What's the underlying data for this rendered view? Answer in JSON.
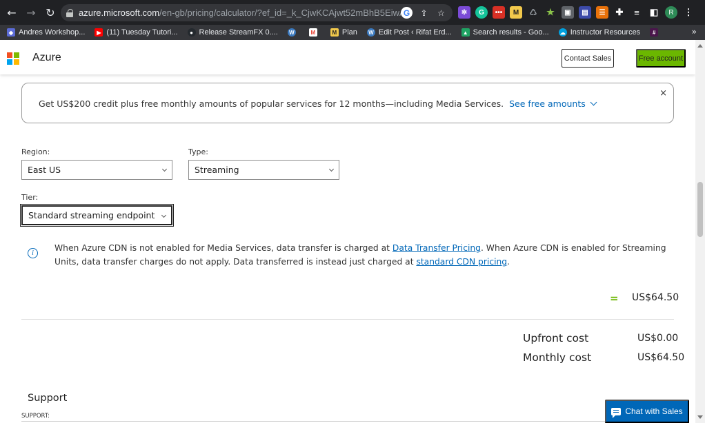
{
  "browser": {
    "url_host": "azure.microsoft.com",
    "url_rest": "/en-gb/pricing/calculator/?ef_id=_k_CjwKCAjwt52mBhB5EiwA05YKo9K-N...",
    "profile_initial": "R",
    "bookmarks": [
      {
        "label": "Andres Workshop...",
        "icon": "shield-icon",
        "color": "#5b6bd6"
      },
      {
        "label": "(11) Tuesday Tutori...",
        "icon": "youtube-icon",
        "color": "#ff0000"
      },
      {
        "label": "Release StreamFX 0....",
        "icon": "github-icon",
        "color": "#24292e"
      },
      {
        "label": "",
        "icon": "wordpress-icon",
        "color": "#3b7ac0"
      },
      {
        "label": "",
        "icon": "gmail-icon",
        "color": "#ea4335"
      },
      {
        "label": "Plan",
        "icon": "miro-icon",
        "color": "#f2c94c"
      },
      {
        "label": "Edit Post ‹ Rifat Erd...",
        "icon": "wordpress-icon",
        "color": "#3b7ac0"
      },
      {
        "label": "Search results - Goo...",
        "icon": "google-drive-icon",
        "color": "#1fa463"
      },
      {
        "label": "Instructor Resources",
        "icon": "salesforce-icon",
        "color": "#00a1e0"
      },
      {
        "label": "",
        "icon": "slack-icon",
        "color": "#e01e5a"
      }
    ]
  },
  "header": {
    "brand": "Azure",
    "contact_sales": "Contact Sales",
    "free_account": "Free account"
  },
  "banner": {
    "text": "Get US$200 credit plus free monthly amounts of popular services for 12 months—including Media Services.",
    "link": "See free amounts",
    "close": "×"
  },
  "form": {
    "region_label": "Region:",
    "region_value": "East US",
    "type_label": "Type:",
    "type_value": "Streaming",
    "tier_label": "Tier:",
    "tier_value": "Standard streaming endpoint"
  },
  "info": {
    "part1": "When Azure CDN is not enabled for Media Services, data transfer is charged at ",
    "link1": "Data Transfer Pricing",
    "part2": ". When Azure CDN is enabled for Streaming Units, data transfer charges do not apply. Data transferred is instead just charged at ",
    "link2": "standard CDN pricing",
    "part3": "."
  },
  "pricing": {
    "equals": "=",
    "line_total": "US$64.50",
    "upfront_label": "Upfront cost",
    "upfront_value": "US$0.00",
    "monthly_label": "Monthly cost",
    "monthly_value": "US$64.50"
  },
  "support": {
    "title": "Support",
    "sub": "SUPPORT:"
  },
  "chat": {
    "label": "Chat with Sales"
  },
  "colors": {
    "accent_blue": "#0067b8",
    "accent_green": "#6bb700"
  }
}
